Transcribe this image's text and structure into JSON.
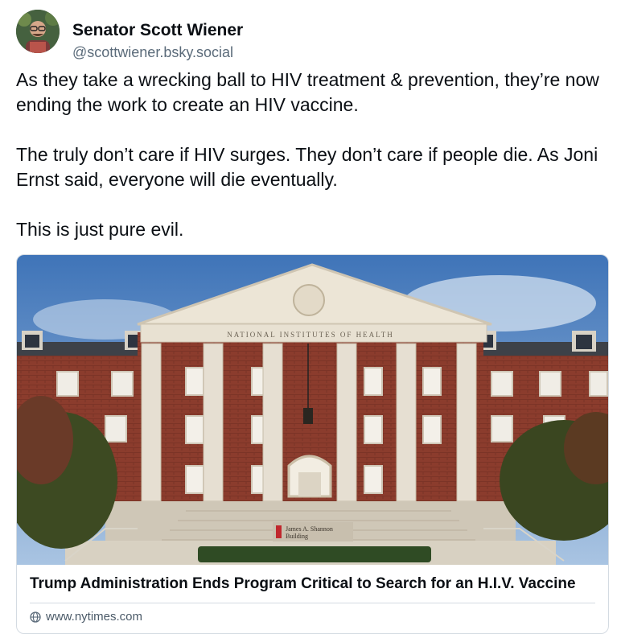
{
  "author": {
    "display_name": "Senator Scott Wiener",
    "handle": "@scottwiener.bsky.social"
  },
  "post": {
    "paragraphs": [
      "As they take a wrecking ball to HIV treatment & prevention, they’re now ending the work to create an HIV vaccine.",
      "The truly don’t care if HIV surges. They don’t care if people die. As Joni Ernst said, everyone will die eventually.",
      "This is just pure evil."
    ]
  },
  "link_card": {
    "image_texts": {
      "frieze": "NATIONAL INSTITUTES OF HEALTH",
      "sign_line1": "James A. Shannon",
      "sign_line2": "Building",
      "sign_number": "1"
    },
    "title": "Trump Administration Ends Program Critical to Search for an H.I.V. Vaccine",
    "domain": "www.nytimes.com"
  },
  "colors": {
    "text": "#0b0f14",
    "muted": "#5b6b7a",
    "border": "#d4dbe2",
    "brick": "#8c3b2c",
    "column": "#e4ddd0",
    "sky": "#7fa9d8"
  },
  "icons": [
    "avatar",
    "globe-icon"
  ]
}
